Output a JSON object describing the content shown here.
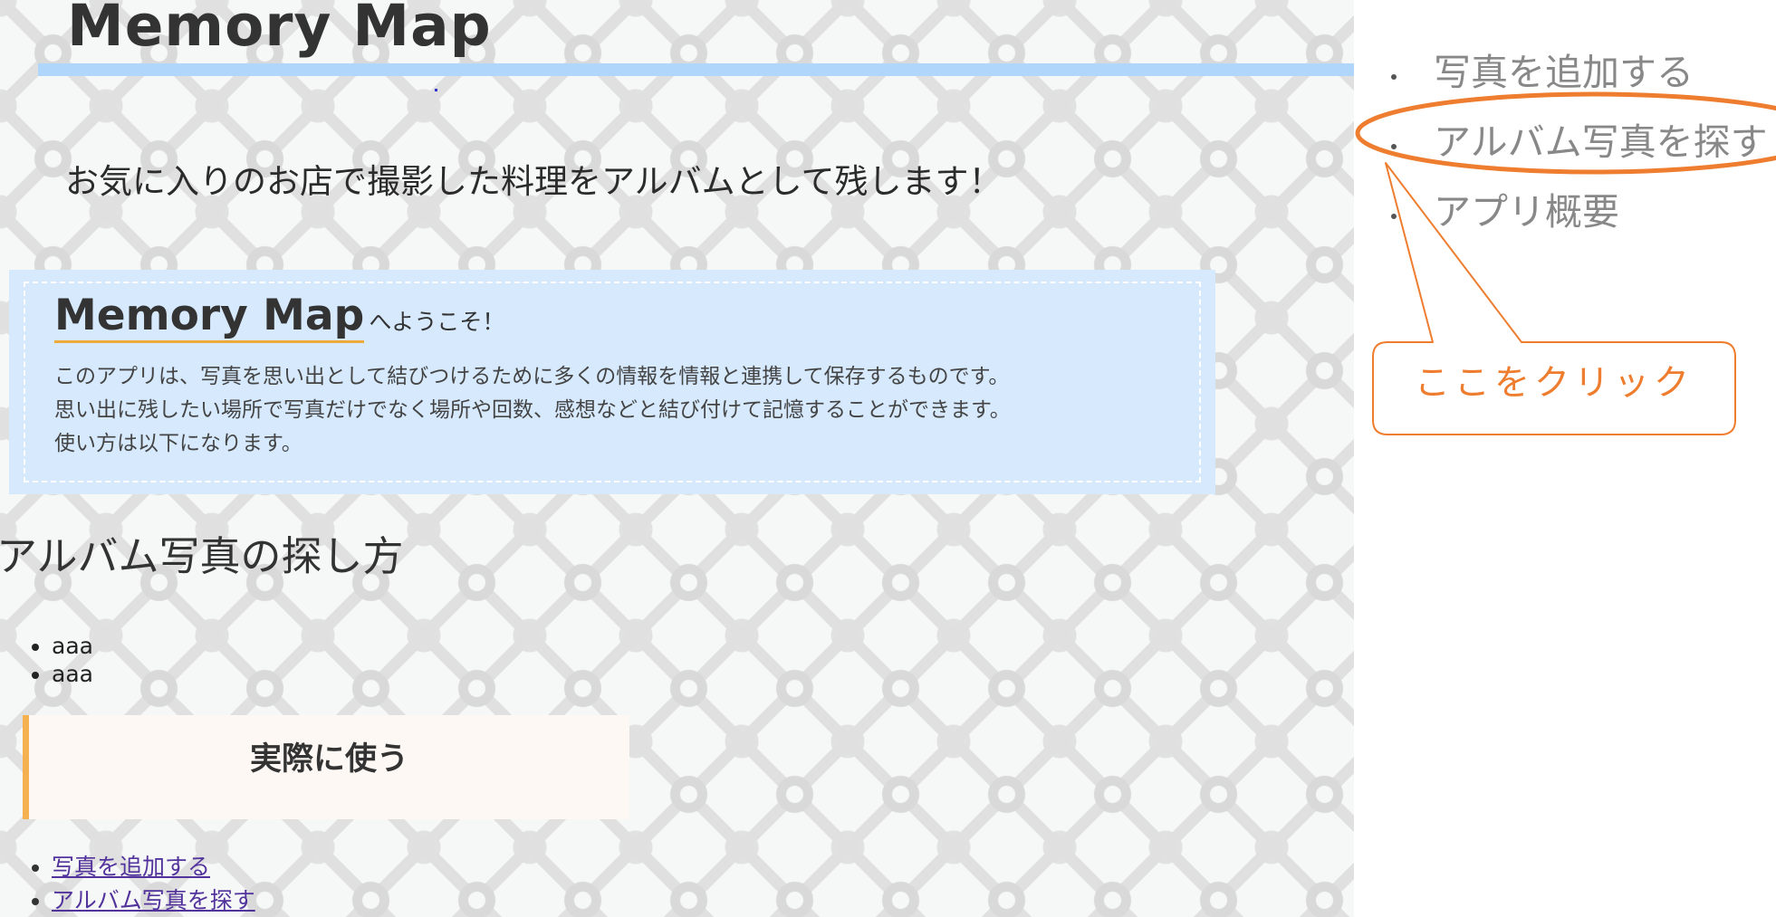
{
  "header": {
    "app_title": "Memory Map"
  },
  "tagline": "お気に入りのお店で撮影した料理をアルバムとして残します！",
  "welcome": {
    "brand": "Memory Map",
    "suffix": "へようこそ！",
    "lines": [
      "このアプリは、写真を思い出として結びつけるために多くの情報を情報と連携して保存するものです。",
      "思い出に残したい場所で写真だけでなく場所や回数、感想などと結び付けて記憶することができます。",
      "使い方は以下になります。"
    ]
  },
  "section": {
    "heading": "アルバム写真の探し方",
    "items": [
      "aaa",
      "aaa"
    ]
  },
  "use_box": {
    "title": "実際に使う"
  },
  "links": [
    "写真を追加する",
    "アルバム写真を探す"
  ],
  "nav": {
    "items": [
      "写真を追加する",
      "アルバム写真を探す",
      "アプリ概要"
    ]
  },
  "callout": {
    "label": "ここをクリック"
  },
  "colors": {
    "title_bar": "#b0d6fb",
    "welcome_bg": "#d6e9fd",
    "accent_orange": "#ee7d2f",
    "use_box_border": "#f5b04f",
    "link": "#52339c",
    "nav_text": "#888888"
  }
}
